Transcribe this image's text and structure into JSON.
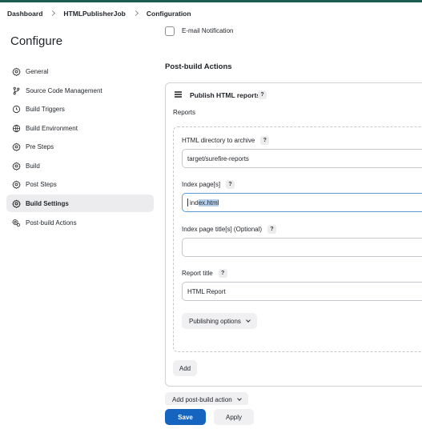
{
  "breadcrumb": [
    "Dashboard",
    "HTMLPublisherJob",
    "Configuration"
  ],
  "sidebar": {
    "title": "Configure",
    "active_index": 7,
    "items": [
      {
        "label": "General",
        "icon": "gear-icon"
      },
      {
        "label": "Source Code Management",
        "icon": "source-branch-icon"
      },
      {
        "label": "Build Triggers",
        "icon": "clock-icon"
      },
      {
        "label": "Build Environment",
        "icon": "globe-icon"
      },
      {
        "label": "Pre Steps",
        "icon": "gear-icon"
      },
      {
        "label": "Build",
        "icon": "gear-icon"
      },
      {
        "label": "Post Steps",
        "icon": "gear-icon"
      },
      {
        "label": "Build Settings",
        "icon": "gear-icon"
      },
      {
        "label": "Post-build Actions",
        "icon": "gears-icon"
      }
    ]
  },
  "main": {
    "email_notification": {
      "label": "E-mail Notification",
      "checked": false
    },
    "post_build_title": "Post-build Actions",
    "publish_card": {
      "title": "Publish HTML reports",
      "help": "?",
      "reports_label": "Reports",
      "fields": {
        "dir": {
          "label": "HTML directory to archive",
          "value": "target/surefire-reports"
        },
        "index": {
          "label": "Index page[s]",
          "value_prefix": "ind",
          "value_selected": "ex.html"
        },
        "index_title": {
          "label": "Index page title[s] (Optional)",
          "value": ""
        },
        "report_title": {
          "label": "Report title",
          "value": "HTML Report"
        }
      },
      "publishing_options": "Publishing options",
      "add": "Add"
    },
    "add_post_build": "Add post-build action",
    "save": "Save",
    "apply": "Apply"
  },
  "colors": {
    "accent": "#1565c0",
    "topbar": "#1e5b4f",
    "active_item_bg": "#ececee"
  }
}
